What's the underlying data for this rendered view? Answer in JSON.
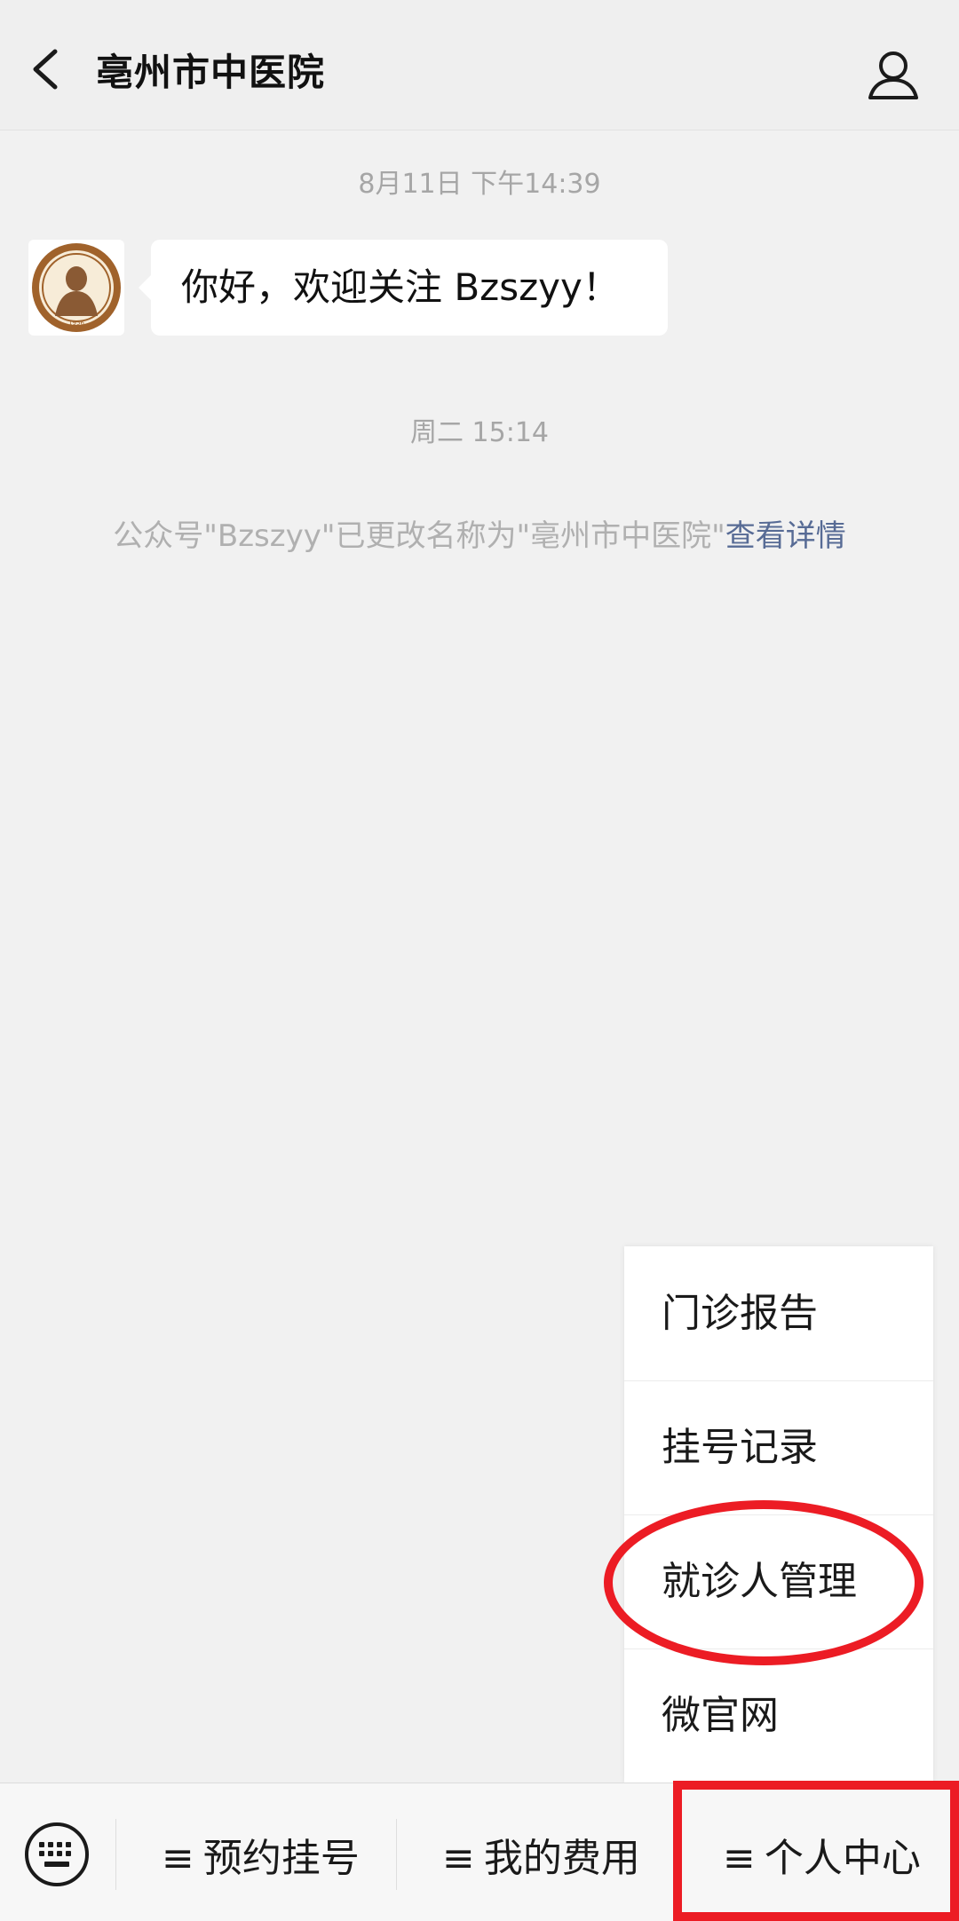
{
  "header": {
    "title": "亳州市中医院",
    "back_icon": "chevron-left-icon",
    "profile_icon": "user-icon"
  },
  "chat": {
    "timestamp_1": "8月11日 下午14:39",
    "welcome_message": "你好，欢迎关注 Bzszyy！",
    "timestamp_2": "周二 15:14",
    "system_note": "公众号\"Bzszyy\"已更改名称为\"亳州市中医院\"",
    "system_link": "查看详情"
  },
  "popup_menu": {
    "items": [
      {
        "label": "门诊报告"
      },
      {
        "label": "挂号记录"
      },
      {
        "label": "就诊人管理"
      },
      {
        "label": "微官网"
      }
    ]
  },
  "bottom_menu": {
    "keyboard_icon": "keyboard-icon",
    "tabs": [
      {
        "icon": "≡",
        "label": "预约挂号"
      },
      {
        "icon": "≡",
        "label": "我的费用"
      },
      {
        "icon": "≡",
        "label": "个人中心"
      }
    ]
  },
  "colors": {
    "background": "#f1f1f1",
    "link": "#576b95",
    "annotation": "#ec1c24"
  }
}
